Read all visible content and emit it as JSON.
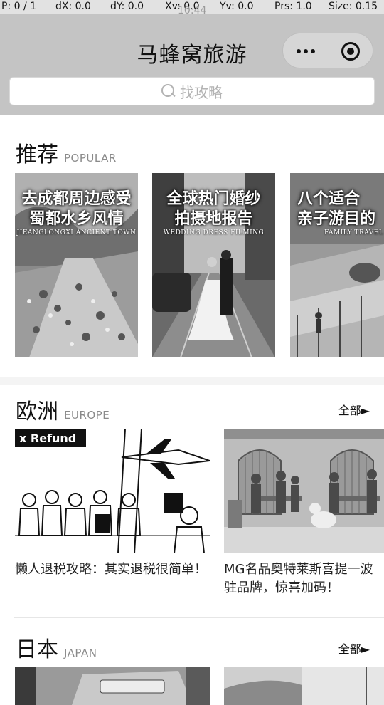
{
  "debug": {
    "p": "P: 0 / 1",
    "dx": "dX: 0.0",
    "dy": "dY: 0.0",
    "xv": "Xv: 0.0",
    "yv": "Yv: 0.0",
    "prs": "Prs: 1.0",
    "size": "Size: 0.15"
  },
  "status": {
    "clock": "10:44"
  },
  "header": {
    "title": "马蜂窝旅游"
  },
  "search": {
    "placeholder": "找攻略"
  },
  "recommend": {
    "title": "推荐",
    "subtitle": "POPULAR",
    "cards": [
      {
        "caption_line1": "去成都周边感受",
        "caption_line2": "蜀都水乡风情",
        "caption_sub": "JIEANGLONGXI ANCIENT TOWN"
      },
      {
        "caption_line1": "全球热门婚纱",
        "caption_line2": "拍摄地报告",
        "caption_sub": "WEDDING DRESS FILMING"
      },
      {
        "caption_line1": "八个适合",
        "caption_line2": "亲子游目的",
        "caption_sub": "FAMILY TRAVEL"
      }
    ]
  },
  "europe": {
    "title": "欧洲",
    "subtitle": "EUROPE",
    "all_label": "全部►",
    "articles": [
      {
        "title": "懒人退税攻略：其实退税很简单！",
        "image_text": "x Refund"
      },
      {
        "title": "MG名品奥特莱斯喜提一波驻品牌，惊喜加码！"
      }
    ]
  },
  "japan": {
    "title": "日本",
    "subtitle": "JAPAN",
    "all_label": "全部►"
  }
}
